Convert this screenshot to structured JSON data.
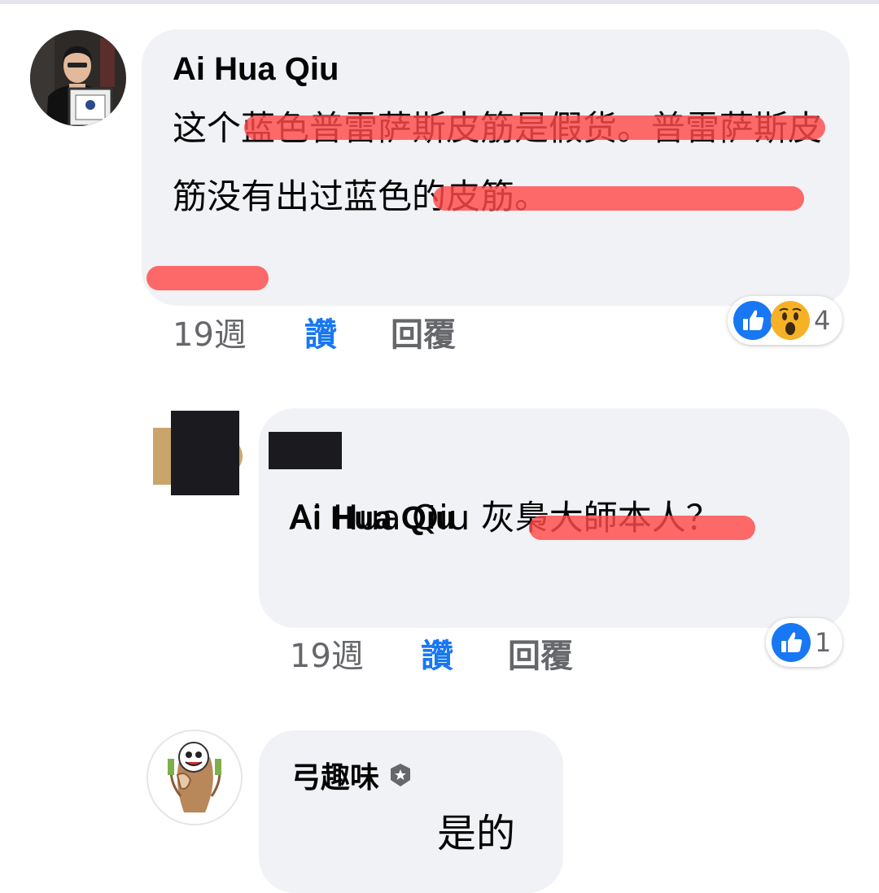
{
  "comments": [
    {
      "author": "Ai Hua Qiu",
      "text": "这个蓝色普雷萨斯皮筋是假货。普雷萨斯皮筋没有出过蓝色的皮筋。",
      "time": "19週",
      "like_label": "讚",
      "reply_label": "回覆",
      "reaction_count": "4",
      "reaction_icons": [
        "like-icon",
        "wow-icon"
      ]
    },
    {
      "author": "",
      "text": "Ai Hua Qiu 灰梟大師本人？",
      "mention": "Ai Hua Qiu",
      "time": "19週",
      "like_label": "讚",
      "reply_label": "回覆",
      "reaction_count": "1",
      "reaction_icons": [
        "like-icon"
      ]
    },
    {
      "author": "弓趣味",
      "text": "是的",
      "badge_icon": "badge-icon"
    }
  ],
  "colors": {
    "like_blue": "#1877f2",
    "bubble_bg": "#f0f2f5",
    "highlight_red": "#ff4b4b"
  }
}
